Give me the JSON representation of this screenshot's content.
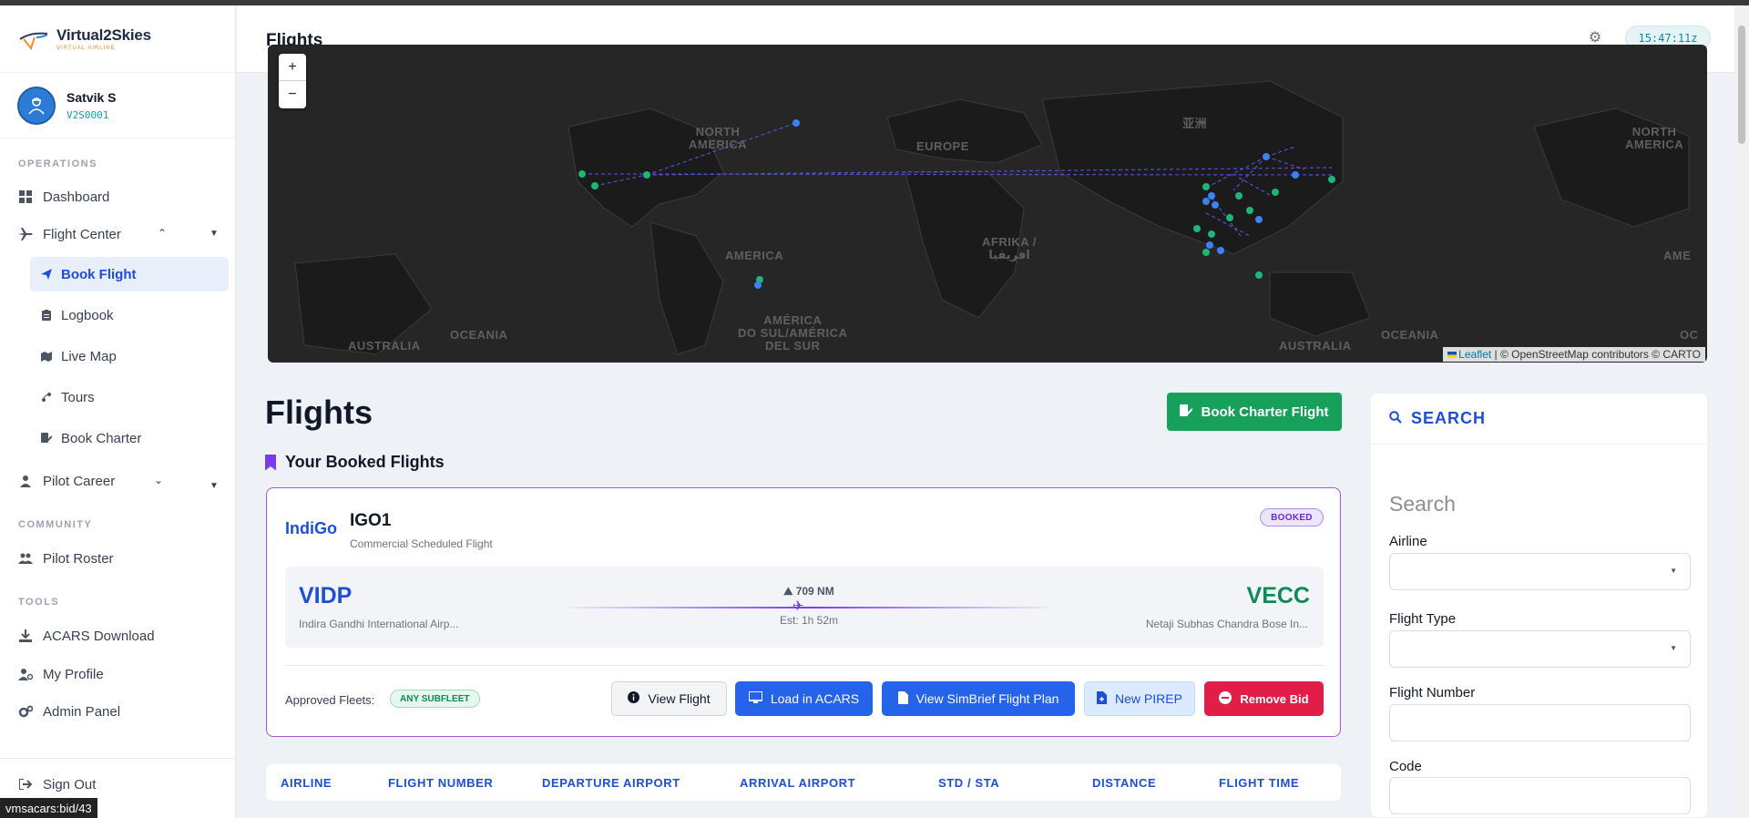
{
  "app": {
    "brand_name": "Virtual2Skies",
    "brand_sub": "VIRTUAL AIRLINE"
  },
  "user": {
    "name": "Satvik S",
    "id": "V2S0001"
  },
  "sidebar": {
    "sections": {
      "operations": "OPERATIONS",
      "community": "COMMUNITY",
      "tools": "TOOLS"
    },
    "items": {
      "dashboard": "Dashboard",
      "flight_center": "Flight Center",
      "book_flight": "Book Flight",
      "logbook": "Logbook",
      "live_map": "Live Map",
      "tours": "Tours",
      "book_charter": "Book Charter",
      "pilot_career": "Pilot Career",
      "pilot_roster": "Pilot Roster",
      "acars_download": "ACARS Download",
      "my_profile": "My Profile",
      "admin_panel": "Admin Panel",
      "sign_out": "Sign Out"
    }
  },
  "status_tooltip": "vmsacars:bid/43",
  "header": {
    "title": "Flights",
    "clock": "15:47:11z"
  },
  "map": {
    "zoom_in": "+",
    "zoom_out": "−",
    "attribution_link": "Leaflet",
    "attribution_text": "| © OpenStreetMap contributors © CARTO",
    "labels": {
      "north_america": "NORTH\nAMERICA",
      "europe": "EUROPE",
      "asia": "亚洲",
      "north_america_2": "NORTH\nAMERICA",
      "america": "AMERICA",
      "afrika": "AFRIKA /\nافريقيا",
      "america_sur": "AMÉRICA\nDO SUL/AMÉRICA\nDEL SUR",
      "oceania_1": "OCEANIA",
      "oceania_2": "OCEANIA",
      "australia_1": "AUSTRALIA",
      "australia_2": "AUSTRALIA",
      "america_2": "AME",
      "oceania_3": "OC"
    }
  },
  "page": {
    "title": "Flights",
    "charter_button": "Book Charter Flight",
    "booked_heading": "Your Booked Flights"
  },
  "booked_flight": {
    "airline": "IndiGo",
    "flight_number": "IGO1",
    "flight_type": "Commercial Scheduled Flight",
    "status": "BOOKED",
    "departure_code": "VIDP",
    "departure_name": "Indira Gandhi International Airp...",
    "arrival_code": "VECC",
    "arrival_name": "Netaji Subhas Chandra Bose In...",
    "distance": "709 NM",
    "estimate": "Est: 1h 52m",
    "fleets_label": "Approved Fleets:",
    "fleets_value": "ANY SUBFLEET",
    "buttons": {
      "view": "View Flight",
      "acars": "Load in ACARS",
      "simbrief": "View SimBrief Flight Plan",
      "pirep": "New PIREP",
      "remove": "Remove Bid"
    }
  },
  "table": {
    "headers": [
      "AIRLINE",
      "FLIGHT NUMBER",
      "DEPARTURE AIRPORT",
      "ARRIVAL AIRPORT",
      "STD / STA",
      "DISTANCE",
      "FLIGHT TIME"
    ]
  },
  "search": {
    "heading": "SEARCH",
    "title": "Search",
    "airline_label": "Airline",
    "airline_value": "",
    "flight_type_label": "Flight Type",
    "flight_type_value": "",
    "flight_number_label": "Flight Number",
    "flight_number_value": "",
    "code_label": "Code",
    "code_value": ""
  },
  "colors": {
    "primary": "#2563eb",
    "success": "#16a05a",
    "danger": "#e11d48",
    "accent_purple": "#7c3aed",
    "map_dot_green": "#1fb57a",
    "map_dot_blue": "#3b82f6"
  }
}
